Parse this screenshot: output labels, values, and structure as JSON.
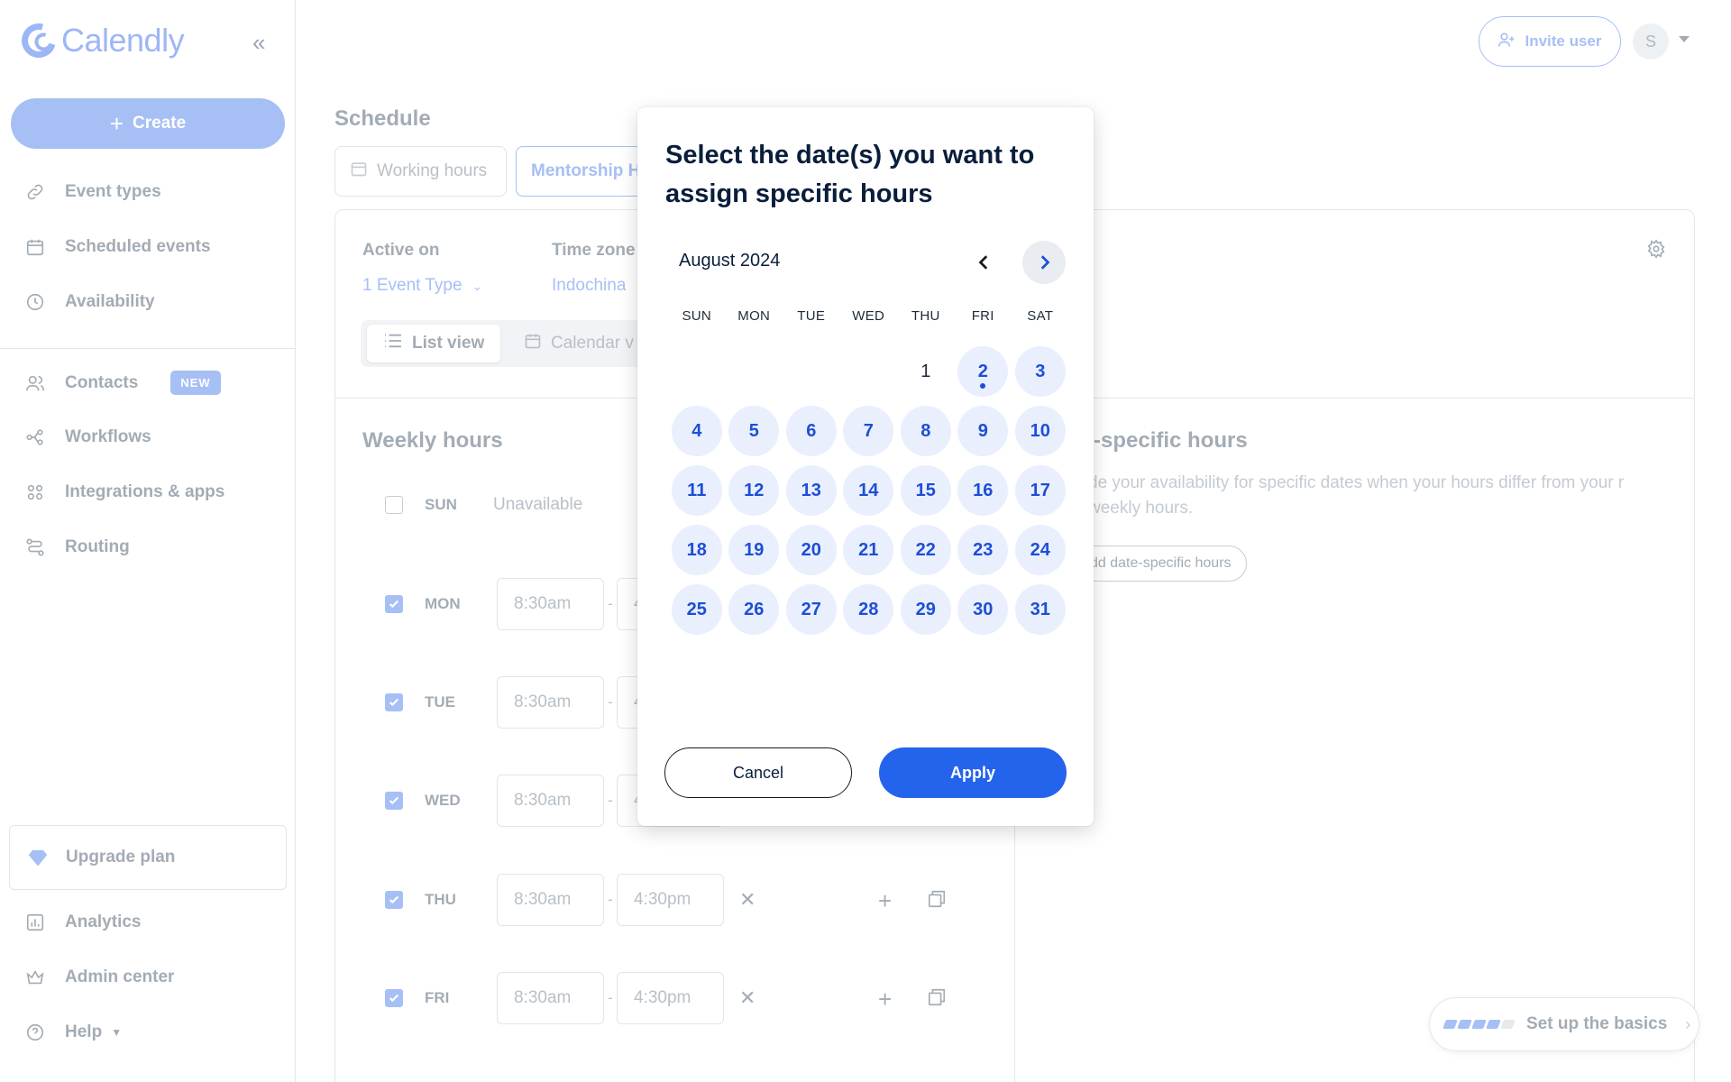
{
  "app": {
    "name": "Calendly"
  },
  "sidebar": {
    "create_label": "Create",
    "items": [
      {
        "label": "Event types",
        "icon": "link-icon"
      },
      {
        "label": "Scheduled events",
        "icon": "calendar-icon"
      },
      {
        "label": "Availability",
        "icon": "clock-icon"
      },
      {
        "label": "Contacts",
        "icon": "contacts-icon",
        "badge": "NEW"
      },
      {
        "label": "Workflows",
        "icon": "workflow-icon"
      },
      {
        "label": "Integrations & apps",
        "icon": "grid-icon"
      },
      {
        "label": "Routing",
        "icon": "routing-icon"
      }
    ],
    "upgrade_label": "Upgrade plan",
    "bottom_items": [
      {
        "label": "Analytics",
        "icon": "analytics-icon"
      },
      {
        "label": "Admin center",
        "icon": "crown-icon"
      },
      {
        "label": "Help",
        "icon": "help-icon"
      }
    ]
  },
  "header": {
    "invite_label": "Invite user",
    "avatar_initial": "S"
  },
  "main": {
    "title": "Schedule",
    "tabs": [
      "Working hours",
      "Mentorship H"
    ],
    "active_on_label": "Active on",
    "active_on_value": "1 Event Type",
    "timezone_label": "Time zone",
    "timezone_value": "Indochina",
    "views": [
      "List view",
      "Calendar v"
    ],
    "weekly_title": "Weekly hours",
    "days": [
      {
        "label": "SUN",
        "checked": false,
        "unavailable": "Unavailable"
      },
      {
        "label": "MON",
        "checked": true,
        "start": "8:30am",
        "end": "4:"
      },
      {
        "label": "TUE",
        "checked": true,
        "start": "8:30am",
        "end": "4:"
      },
      {
        "label": "WED",
        "checked": true,
        "start": "8:30am",
        "end": "4:"
      },
      {
        "label": "THU",
        "checked": true,
        "start": "8:30am",
        "end": "4:30pm"
      },
      {
        "label": "FRI",
        "checked": true,
        "start": "8:30am",
        "end": "4:30pm"
      }
    ],
    "date_specific_title": "-specific hours",
    "date_specific_desc": "de your availability for specific dates when your hours differ from your r weekly hours.",
    "date_specific_button": "dd date-specific hours"
  },
  "setup_widget": {
    "label": "Set up the basics",
    "progress_filled": 4,
    "progress_total": 5
  },
  "modal": {
    "title": "Select the date(s) you want to assign specific hours",
    "month": "August 2024",
    "weekdays": [
      "SUN",
      "MON",
      "TUE",
      "WED",
      "THU",
      "FRI",
      "SAT"
    ],
    "leading_blanks": 4,
    "days": [
      {
        "d": "1",
        "available": false
      },
      {
        "d": "2",
        "available": true,
        "today": true
      },
      {
        "d": "3",
        "available": true
      },
      {
        "d": "4",
        "available": true
      },
      {
        "d": "5",
        "available": true
      },
      {
        "d": "6",
        "available": true
      },
      {
        "d": "7",
        "available": true
      },
      {
        "d": "8",
        "available": true
      },
      {
        "d": "9",
        "available": true
      },
      {
        "d": "10",
        "available": true
      },
      {
        "d": "11",
        "available": true
      },
      {
        "d": "12",
        "available": true
      },
      {
        "d": "13",
        "available": true
      },
      {
        "d": "14",
        "available": true
      },
      {
        "d": "15",
        "available": true
      },
      {
        "d": "16",
        "available": true
      },
      {
        "d": "17",
        "available": true
      },
      {
        "d": "18",
        "available": true
      },
      {
        "d": "19",
        "available": true
      },
      {
        "d": "20",
        "available": true
      },
      {
        "d": "21",
        "available": true
      },
      {
        "d": "22",
        "available": true
      },
      {
        "d": "23",
        "available": true
      },
      {
        "d": "24",
        "available": true
      },
      {
        "d": "25",
        "available": true
      },
      {
        "d": "26",
        "available": true
      },
      {
        "d": "27",
        "available": true
      },
      {
        "d": "28",
        "available": true
      },
      {
        "d": "29",
        "available": true
      },
      {
        "d": "30",
        "available": true
      },
      {
        "d": "31",
        "available": true
      }
    ],
    "cancel_label": "Cancel",
    "apply_label": "Apply"
  },
  "colors": {
    "primary": "#2463eb",
    "muted_primary": "#a6bff5",
    "available_day_bg": "#e9effd"
  }
}
